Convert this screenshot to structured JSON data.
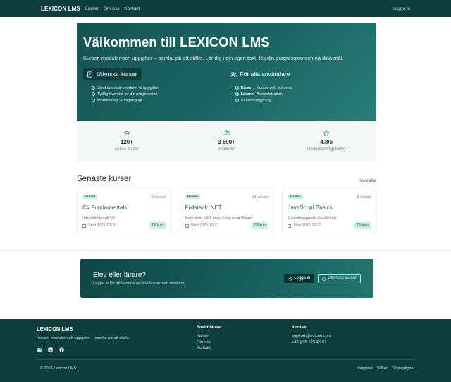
{
  "nav": {
    "brand": "LEXICON LMS",
    "links": [
      "Kurser",
      "Om oss",
      "Kontakt"
    ],
    "login": "Logga in"
  },
  "hero": {
    "title": "Välkommen till LEXICON LMS",
    "subtitle": "Kurser, moduler och uppgifter – samlat på ett ställe. Lär dig i din egen takt, följ din progression och nå dina mål.",
    "left": {
      "heading": "Utforska kurser",
      "items": [
        "Strukturerade moduler & uppgifter",
        "Tydlig översikt av din progression",
        "Mobilvänligt & tillgängligt"
      ]
    },
    "right": {
      "heading": "För alla användare",
      "items": [
        {
          "bold": "Elever:",
          "text": "Kurser och schema"
        },
        {
          "bold": "Lärare:",
          "text": "Administration"
        },
        {
          "bold": "",
          "text": "Säker inloggning"
        }
      ]
    }
  },
  "stats": [
    {
      "icon": "graduation-cap-icon",
      "value": "120+",
      "label": "Aktiva kurser"
    },
    {
      "icon": "users-icon",
      "value": "3 500+",
      "label": "Studenter"
    },
    {
      "icon": "star-icon",
      "value": "4.8/5",
      "label": "Genomsnittligt betyg"
    }
  ],
  "courses": {
    "title": "Senaste kurser",
    "see_all": "Visa alla",
    "items": [
      {
        "badge": "Modell",
        "weeks": "9 veckor",
        "title": "C# Fundamentals",
        "desc": "Introduktion till C#",
        "start": "Start 2025-10-30",
        "button": "Till kurs"
      },
      {
        "badge": "Modell",
        "weeks": "14 veckor",
        "title": "Fullstack .NET",
        "desc": "Komplett .NET utveckling med Blazor",
        "start": "Start 2025-10-27",
        "button": "Till kurs"
      },
      {
        "badge": "Modell",
        "weeks": "8 veckor",
        "title": "JavaScript Basics",
        "desc": "Grundläggande JavaScript",
        "start": "Start 2025-10-23",
        "button": "Till kurs"
      }
    ]
  },
  "cta": {
    "title": "Elev eller lärare?",
    "subtitle": "Logga in för att komma åt dina kurser och moduler.",
    "login": "Logga in",
    "explore": "Utforska kurser"
  },
  "footer": {
    "brand": "LEXICON LMS",
    "tagline": "Kurser, moduler och uppgifter – samlat på ett ställe.",
    "quick_head": "Snabblänkar",
    "quick_links": [
      "Kurser",
      "Om oss",
      "Kontakt"
    ],
    "contact_head": "Kontakt",
    "contact": [
      "support@lexicon.com",
      "+46 (0)8 123 45 67"
    ],
    "copyright": "© 2026 Lexicon LMS",
    "legal": [
      "Integritet",
      "Villkor",
      "Tillgänglighet"
    ]
  },
  "colors": {
    "primary": "#0d3d3d",
    "accent": "#1a6664",
    "badge_bg": "#cfeee8"
  }
}
